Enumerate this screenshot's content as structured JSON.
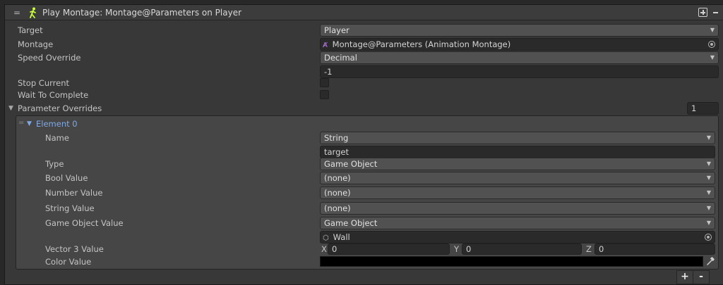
{
  "header": {
    "title": "Play Montage: Montage@Parameters on Player",
    "drag_handle_icon": "=",
    "node_icon": "walking-figure-icon",
    "add_icon": "plus-box-icon",
    "remove_icon": "minus-icon"
  },
  "fields": {
    "target": {
      "label": "Target",
      "value": "Player"
    },
    "montage": {
      "label": "Montage",
      "value": "Montage@Parameters (Animation Montage)"
    },
    "speed_override": {
      "label": "Speed Override",
      "value": "Decimal",
      "number": "-1"
    },
    "stop_current": {
      "label": "Stop Current",
      "checked": false
    },
    "wait_to_complete": {
      "label": "Wait To Complete",
      "checked": false
    },
    "parameter_overrides": {
      "label": "Parameter Overrides",
      "count": "1"
    }
  },
  "element": {
    "title": "Element 0",
    "name": {
      "label": "Name",
      "value": "String",
      "text": "target"
    },
    "type": {
      "label": "Type",
      "value": "Game Object"
    },
    "bool_value": {
      "label": "Bool Value",
      "value": "(none)"
    },
    "number_value": {
      "label": "Number Value",
      "value": "(none)"
    },
    "string_value": {
      "label": "String Value",
      "value": "(none)"
    },
    "game_object_value": {
      "label": "Game Object Value",
      "value": "Game Object",
      "object": "Wall"
    },
    "vector3_value": {
      "label": "Vector 3 Value",
      "x_label": "X",
      "x": "0",
      "y_label": "Y",
      "y": "0",
      "z_label": "Z",
      "z": "0"
    },
    "color_value": {
      "label": "Color Value",
      "color": "#000000"
    }
  },
  "footer": {
    "add_label": "+",
    "remove_label": "-"
  },
  "colors": {
    "accent": "#7fa9e6",
    "node_icon": "#c8ff3a",
    "montage_icon": "#b678e8"
  }
}
